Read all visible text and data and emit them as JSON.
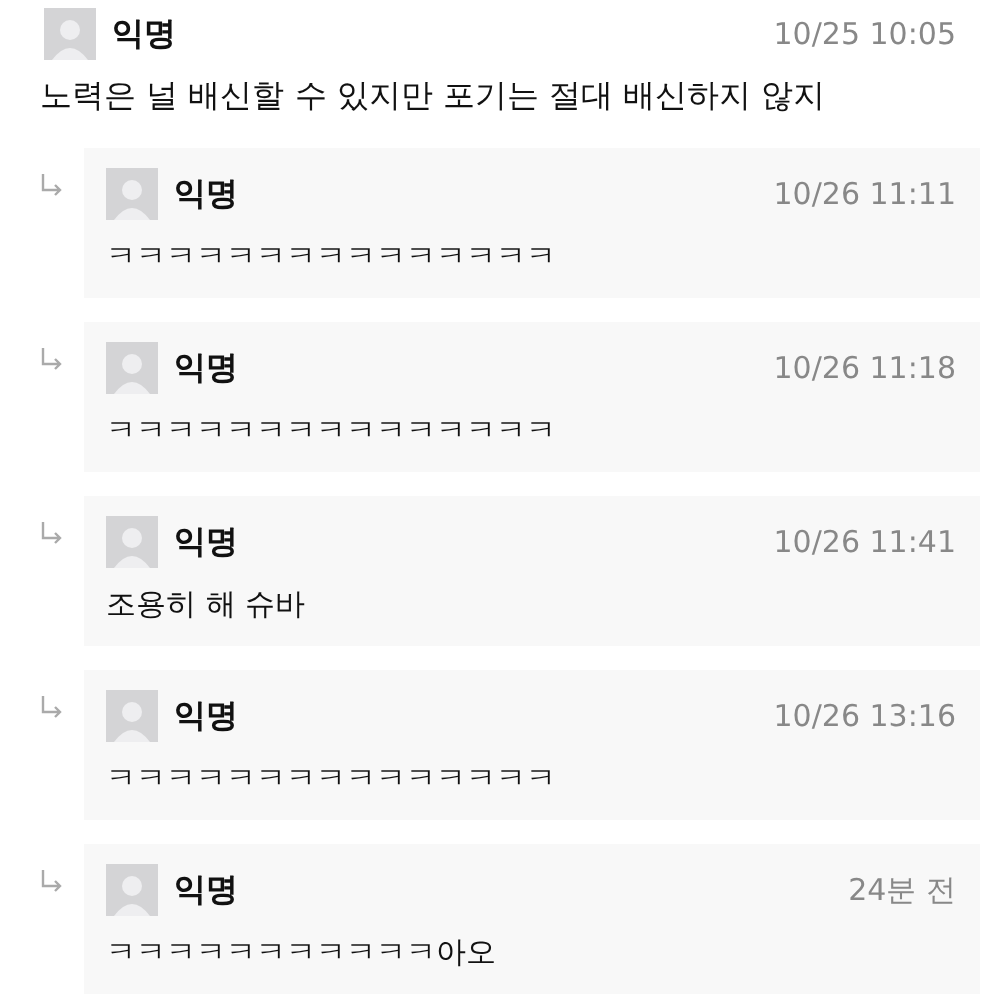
{
  "comment": {
    "author": "익명",
    "time": "10/25 10:05",
    "text": "노력은 널 배신할 수 있지만 포기는 절대 배신하지 않지"
  },
  "replies": [
    {
      "author": "익명",
      "time": "10/26 11:11",
      "text": "ㅋㅋㅋㅋㅋㅋㅋㅋㅋㅋㅋㅋㅋㅋㅋ"
    },
    {
      "author": "익명",
      "time": "10/26 11:18",
      "text": "ㅋㅋㅋㅋㅋㅋㅋㅋㅋㅋㅋㅋㅋㅋㅋ"
    },
    {
      "author": "익명",
      "time": "10/26 11:41",
      "text": "조용히 해 슈바"
    },
    {
      "author": "익명",
      "time": "10/26 13:16",
      "text": "ㅋㅋㅋㅋㅋㅋㅋㅋㅋㅋㅋㅋㅋㅋㅋ"
    },
    {
      "author": "익명",
      "time": "24분 전",
      "text": "ㅋㅋㅋㅋㅋㅋㅋㅋㅋㅋㅋ아오"
    }
  ]
}
